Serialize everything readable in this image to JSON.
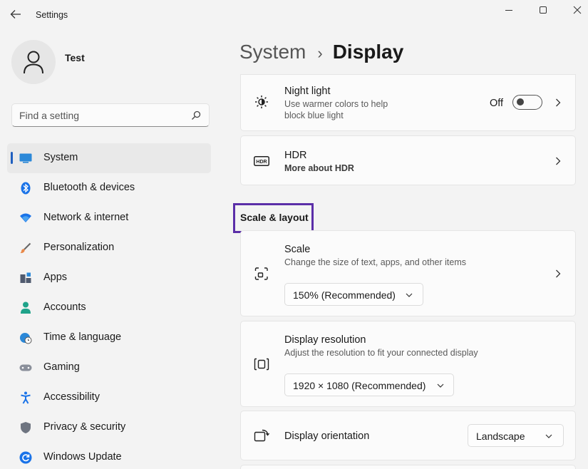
{
  "window": {
    "title": "Settings"
  },
  "profile": {
    "name": "Test"
  },
  "search": {
    "placeholder": "Find a setting"
  },
  "sidebar": {
    "items": [
      {
        "label": "System",
        "icon": "system-icon",
        "active": true
      },
      {
        "label": "Bluetooth & devices",
        "icon": "bluetooth-icon"
      },
      {
        "label": "Network & internet",
        "icon": "wifi-icon"
      },
      {
        "label": "Personalization",
        "icon": "brush-icon"
      },
      {
        "label": "Apps",
        "icon": "apps-icon"
      },
      {
        "label": "Accounts",
        "icon": "person-icon"
      },
      {
        "label": "Time & language",
        "icon": "globe-clock-icon"
      },
      {
        "label": "Gaming",
        "icon": "gamepad-icon"
      },
      {
        "label": "Accessibility",
        "icon": "accessibility-icon"
      },
      {
        "label": "Privacy & security",
        "icon": "shield-icon"
      },
      {
        "label": "Windows Update",
        "icon": "update-icon"
      }
    ]
  },
  "breadcrumb": {
    "parent": "System",
    "separator": "›",
    "current": "Display"
  },
  "night_light": {
    "title": "Night light",
    "description_line1": "Use warmer colors to help",
    "description_line2": "block blue light",
    "toggle_state": "Off",
    "toggle_on": false
  },
  "hdr": {
    "title": "HDR",
    "link_text": "More about HDR"
  },
  "scale_layout": {
    "heading": "Scale & layout",
    "scale": {
      "title": "Scale",
      "description": "Change the size of text, apps, and other items",
      "value": "150% (Recommended)"
    },
    "resolution": {
      "title": "Display resolution",
      "description": "Adjust the resolution to fit your connected display",
      "value": "1920 × 1080 (Recommended)"
    },
    "orientation": {
      "title": "Display orientation",
      "value": "Landscape"
    }
  },
  "colors": {
    "accent": "#1f5fbf",
    "highlight_box": "#5b2ea8",
    "card_bg": "#fbfbfb",
    "window_bg": "#f3f3f3"
  }
}
